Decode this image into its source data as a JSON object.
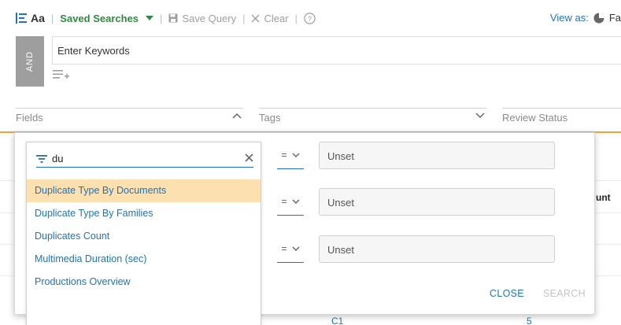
{
  "toolbar": {
    "aa_label": "Aa",
    "saved_searches": "Saved Searches",
    "save_query": "Save Query",
    "clear": "Clear",
    "view_as": "View as:",
    "view_as_value": "Fa"
  },
  "query": {
    "operator": "AND",
    "keywords_value": "Enter Keywords"
  },
  "filters": {
    "fields": "Fields",
    "tags": "Tags",
    "review_status": "Review Status"
  },
  "field_search": {
    "value": "du",
    "items": [
      {
        "label": "Duplicate Type By Documents"
      },
      {
        "label": "Duplicate Type By Families"
      },
      {
        "label": "Duplicates Count"
      },
      {
        "label": "Multimedia Duration (sec)"
      },
      {
        "label": "Productions Overview"
      }
    ]
  },
  "conditions": [
    {
      "operator": "=",
      "value": "Unset"
    },
    {
      "operator": "=",
      "value": "Unset"
    },
    {
      "operator": "=",
      "value": "Unset"
    }
  ],
  "actions": {
    "close": "CLOSE",
    "search": "SEARCH"
  },
  "background": {
    "count_header": "unt",
    "cell_c1": "C1",
    "cell_5": "5"
  },
  "colors": {
    "accent_blue": "#1e73be",
    "saved_green": "#2e8b3e",
    "highlight": "#fde0b0",
    "orange": "#f2a33a"
  }
}
